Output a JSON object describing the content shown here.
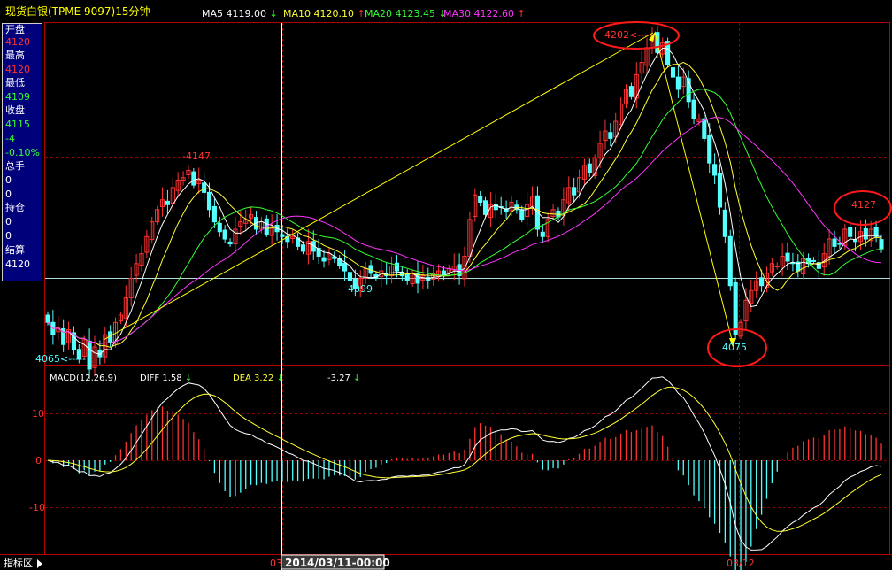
{
  "header": {
    "title": "现货白银(TPME 9097)15分钟",
    "ma": [
      {
        "label": "MA5",
        "value": "4119.00",
        "arrow": "↓",
        "color": "#ffffff"
      },
      {
        "label": "MA10",
        "value": "4120.10",
        "arrow": "↑",
        "color": "#ffff33"
      },
      {
        "label": "MA20",
        "value": "4123.45",
        "arrow": "↓",
        "color": "#33ff33"
      },
      {
        "label": "MA30",
        "value": "4122.60",
        "arrow": "↑",
        "color": "#ff33ff"
      }
    ]
  },
  "info_panel": {
    "open_label": "开盘",
    "open_value": "4120",
    "high_label": "最高",
    "high_value": "4120",
    "low_label": "最低",
    "low_value": "4109",
    "close_label": "收盘",
    "close_value": "4115",
    "change_value": "-4",
    "change_pct": "-0.10%",
    "volume_label": "总手",
    "volume_value": "0",
    "volume_value2": "0",
    "position_label": "持仓",
    "position_value": "0",
    "position_value2": "0",
    "settle_label": "结算",
    "settle_value": "4120"
  },
  "macd_header": {
    "label": "MACD(12,26,9)",
    "diff_label": "DIFF",
    "diff_value": "1.58",
    "diff_arrow": "↓",
    "dea_label": "DEA",
    "dea_value": "3.22",
    "dea_arrow": "↓",
    "macd_value": "-3.27",
    "macd_arrow": "↓"
  },
  "footer": {
    "indicator_tab": "指标区",
    "cursor_date": "2014/03/11-00:00",
    "date_label": "03/12",
    "left_date_fragment": "03"
  },
  "colors": {
    "up": "#ff3232",
    "down": "#54ffff",
    "grid": "#8b0000",
    "ma5": "#ffffff",
    "ma10": "#ffff33",
    "ma20": "#33ff33",
    "ma30": "#ff33ff",
    "annotation": "#ff1a1a",
    "trend": "#ffff00"
  },
  "chart_data": [
    {
      "type": "candlestick",
      "title": "现货白银(TPME 9097)15分钟",
      "ylim": [
        4057,
        4207
      ],
      "price_ticks": [
        4202,
        4147,
        4120,
        4099,
        4075
      ],
      "closes": [
        4085,
        4080,
        4083,
        4076,
        4082,
        4074,
        4070,
        4078,
        4066,
        4075,
        4071,
        4080,
        4077,
        4085,
        4088,
        4095,
        4103,
        4109,
        4113,
        4120,
        4126,
        4131,
        4135,
        4133,
        4140,
        4143,
        4144,
        4147,
        4141,
        4143,
        4138,
        4131,
        4126,
        4122,
        4119,
        4117,
        4123,
        4126,
        4127,
        4129,
        4123,
        4126,
        4121,
        4124,
        4122,
        4120,
        4118,
        4120,
        4116,
        4114,
        4118,
        4114,
        4112,
        4110,
        4113,
        4111,
        4108,
        4106,
        4102,
        4099,
        4103,
        4107,
        4105,
        4103,
        4106,
        4104,
        4108,
        4106,
        4104,
        4102,
        4105,
        4101,
        4104,
        4102,
        4105,
        4106,
        4104,
        4107,
        4108,
        4104,
        4112,
        4127,
        4137,
        4134,
        4129,
        4133,
        4131,
        4132,
        4130,
        4134,
        4131,
        4127,
        4133,
        4136,
        4123,
        4120,
        4127,
        4131,
        4128,
        4135,
        4140,
        4137,
        4144,
        4149,
        4146,
        4152,
        4158,
        4163,
        4160,
        4167,
        4174,
        4180,
        4177,
        4186,
        4191,
        4197,
        4202,
        4195,
        4199,
        4190,
        4185,
        4180,
        4185,
        4175,
        4168,
        4168,
        4160,
        4150,
        4145,
        4132,
        4120,
        4100,
        4080,
        4085,
        4094,
        4098,
        4102,
        4100,
        4105,
        4109,
        4108,
        4112,
        4110,
        4109,
        4106,
        4111,
        4109,
        4110,
        4107,
        4113,
        4119,
        4116,
        4117,
        4123,
        4120,
        4118,
        4122,
        4119,
        4123,
        4120,
        4115
      ],
      "annotations": [
        {
          "label": "4202",
          "type": "high"
        },
        {
          "label": "4147",
          "type": "high"
        },
        {
          "label": "4099",
          "type": "low"
        },
        {
          "label": "4075",
          "type": "low"
        },
        {
          "label": "4127",
          "type": "high"
        },
        {
          "label": "4065",
          "type": "low"
        }
      ],
      "series": [
        {
          "name": "MA5",
          "value": 4119.0
        },
        {
          "name": "MA10",
          "value": 4120.1
        },
        {
          "name": "MA20",
          "value": 4123.45
        },
        {
          "name": "MA30",
          "value": 4122.6
        }
      ]
    },
    {
      "type": "bar",
      "title": "MACD(12,26,9)",
      "ylim": [
        -18,
        15
      ],
      "y_ticks": [
        10,
        0,
        -10
      ],
      "series": [
        {
          "name": "DIFF",
          "last": 1.58
        },
        {
          "name": "DEA",
          "last": 3.22
        },
        {
          "name": "MACD",
          "last": -3.27
        }
      ]
    }
  ]
}
